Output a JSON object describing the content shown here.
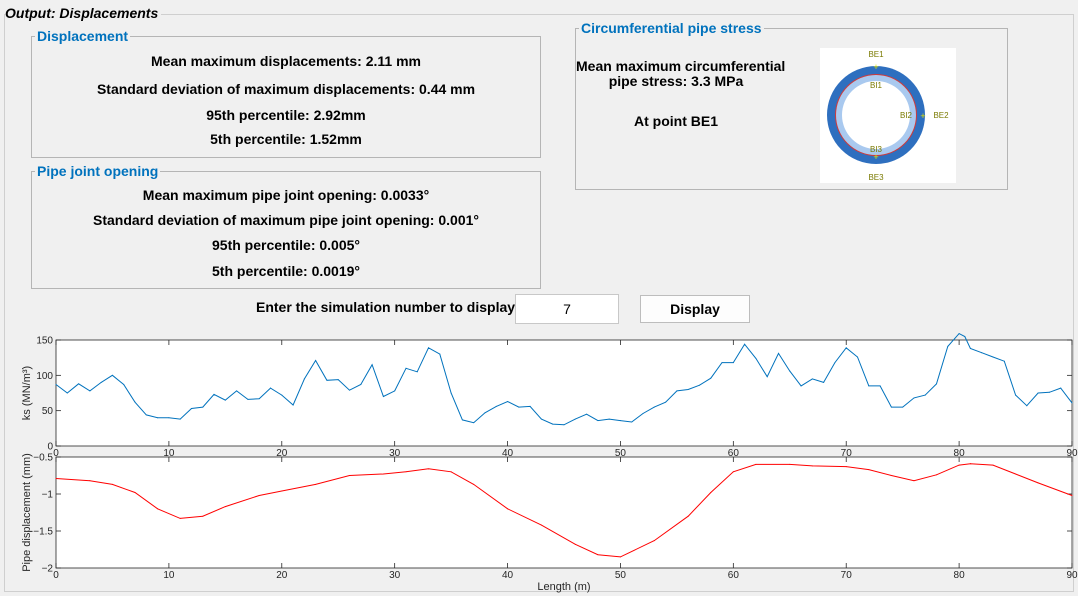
{
  "window": {
    "title": "Output: Displacements"
  },
  "displacement": {
    "title": "Displacement",
    "mean": "Mean maximum displacements: 2.11 mm",
    "std": "Standard deviation of maximum displacements: 0.44 mm",
    "p95": "95th percentile: 2.92mm",
    "p5": "5th percentile: 1.52mm"
  },
  "joint": {
    "title": "Pipe joint opening",
    "mean": "Mean maximum pipe joint opening: 0.0033°",
    "std": "Standard deviation of maximum pipe joint opening: 0.001°",
    "p95": "95th percentile: 0.005°",
    "p5": "5th percentile: 0.0019°"
  },
  "stress": {
    "title": "Circumferential pipe stress",
    "line1": "Mean maximum circumferential",
    "line2": "pipe stress: 3.3 MPa",
    "point": "At point BE1",
    "labels": {
      "be1": "BE1",
      "bi1": "BI1",
      "bi2": "BI2",
      "be2": "BE2",
      "bi3": "BI3",
      "be3": "BE3"
    }
  },
  "simulation": {
    "prompt": "Enter the simulation number to display",
    "value": "7",
    "button": "Display"
  },
  "chart_data": [
    {
      "type": "line",
      "ylabel": "ks (MN/m³)",
      "xlim": [
        0,
        90
      ],
      "ylim": [
        0,
        150
      ],
      "xticks": [
        0,
        10,
        20,
        30,
        40,
        50,
        60,
        70,
        80,
        90
      ],
      "yticks": [
        0,
        50,
        100,
        150
      ],
      "color": "#0072bd",
      "series": [
        {
          "x": [
            0,
            1,
            2,
            3,
            4,
            5,
            6,
            7,
            8,
            9,
            10,
            11,
            12,
            13,
            14,
            15,
            16,
            17,
            18,
            19,
            20,
            21,
            22,
            23,
            24,
            25,
            26,
            27,
            28,
            29,
            30,
            31,
            32,
            33,
            34,
            35,
            36,
            37,
            38,
            39,
            40,
            41,
            42,
            43,
            44,
            45,
            46,
            47,
            48,
            49,
            50,
            51,
            52,
            53,
            54,
            55,
            56,
            57,
            58,
            59,
            60,
            61,
            62,
            63,
            64,
            65,
            66,
            67,
            68,
            69,
            70,
            71,
            72,
            73,
            74,
            75,
            76,
            77,
            78,
            79,
            80,
            80.5,
            81,
            82,
            83,
            84,
            85,
            86,
            87,
            88,
            89,
            90
          ],
          "y": [
            87,
            75,
            88,
            78,
            90,
            100,
            87,
            62,
            44,
            40,
            40,
            38,
            53,
            55,
            73,
            65,
            78,
            66,
            67,
            82,
            72,
            58,
            95,
            121,
            93,
            94,
            79,
            87,
            115,
            70,
            78,
            110,
            105,
            139,
            130,
            75,
            37,
            33,
            47,
            56,
            63,
            55,
            56,
            38,
            31,
            30,
            38,
            45,
            36,
            38,
            36,
            34,
            46,
            55,
            62,
            78,
            80,
            86,
            96,
            118,
            118,
            144,
            124,
            98,
            131,
            106,
            85,
            95,
            90,
            118,
            139,
            126,
            85,
            85,
            55,
            55,
            68,
            72,
            88,
            141,
            159,
            155,
            138,
            132,
            126,
            120,
            72,
            57,
            75,
            76,
            82,
            61
          ]
        }
      ]
    },
    {
      "type": "line",
      "ylabel": "Pipe displacement (mm)",
      "xlabel": "Length (m)",
      "xlim": [
        0,
        90
      ],
      "ylim": [
        -2,
        -0.5
      ],
      "xticks": [
        0,
        10,
        20,
        30,
        40,
        50,
        60,
        70,
        80,
        90
      ],
      "yticks": [
        -2,
        -1.5,
        -1,
        -0.5
      ],
      "color": "#ff0000",
      "series": [
        {
          "x": [
            0,
            3,
            5,
            7,
            9,
            11,
            13,
            15,
            18,
            20,
            23,
            26,
            29,
            31,
            33,
            35,
            37,
            40,
            43,
            46,
            48,
            50,
            53,
            56,
            58,
            60,
            62,
            65,
            67,
            70,
            72,
            74,
            76,
            78,
            80,
            81,
            83,
            85,
            87,
            90
          ],
          "y": [
            -0.79,
            -0.82,
            -0.87,
            -0.98,
            -1.2,
            -1.33,
            -1.3,
            -1.17,
            -1.02,
            -0.96,
            -0.87,
            -0.75,
            -0.73,
            -0.7,
            -0.66,
            -0.7,
            -0.87,
            -1.2,
            -1.42,
            -1.68,
            -1.82,
            -1.85,
            -1.63,
            -1.3,
            -0.98,
            -0.7,
            -0.6,
            -0.6,
            -0.62,
            -0.63,
            -0.67,
            -0.75,
            -0.82,
            -0.74,
            -0.61,
            -0.59,
            -0.61,
            -0.73,
            -0.85,
            -1.02
          ]
        }
      ]
    }
  ]
}
